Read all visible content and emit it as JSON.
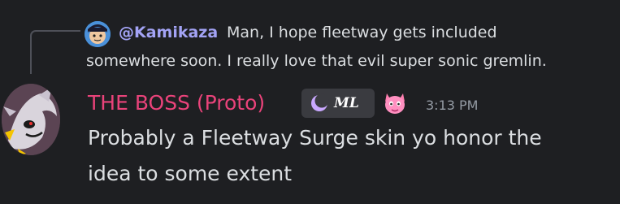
{
  "reply": {
    "author": "@Kamikaza",
    "text_line1": "Man, I hope fleetway gets included",
    "text_line2": "somewhere soon.  I really love that evil super sonic gremlin."
  },
  "message": {
    "username": "THE BOSS (Proto)",
    "guild_tag": "ML",
    "timestamp": "3:13 PM",
    "content_line1": "Probably a Fleetway Surge skin yo honor the",
    "content_line2": "idea to some extent"
  },
  "colors": {
    "background": "#1e1f22",
    "username": "#e9437a",
    "reply_author": "#a3a3f5",
    "text": "#dbdee1",
    "timestamp": "#949ba4"
  },
  "icons": {
    "reply_avatar": "kamikaza-avatar-icon",
    "avatar": "user-avatar",
    "tag_icon": "crescent-moon-icon",
    "role_icon": "pink-creature-role-icon"
  }
}
